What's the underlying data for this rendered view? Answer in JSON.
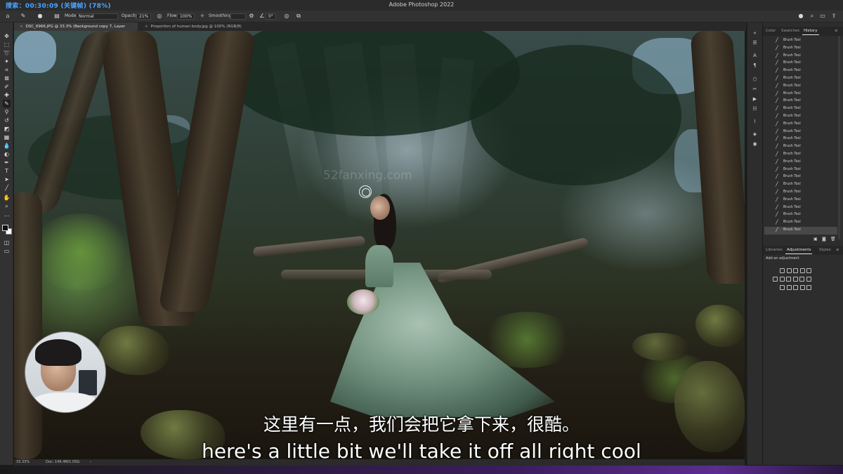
{
  "overlay": {
    "timer": "搜索：00:30:09 (关键帧) (78%)"
  },
  "app": {
    "title": "Adobe Photoshop 2022"
  },
  "options": {
    "mode_label": "Mode:",
    "mode_value": "Normal",
    "opacity_label": "Opacity:",
    "opacity_value": "21%",
    "flow_label": "Flow:",
    "flow_value": "100%",
    "smoothing_label": "Smoothing:",
    "angle_value": "0°"
  },
  "tabs": [
    {
      "label": "DSC_6966.JPG @ 33.3% (Background copy 7, Layer Mask/8) *"
    },
    {
      "label": "Proportion of human body.jpg @ 100% (RGB/8)"
    }
  ],
  "canvas": {
    "watermark": "52fanxing.com"
  },
  "subtitles": {
    "chinese": "这里有一点，我们会把它拿下来，很酷。",
    "english": "here's a little bit we'll take it off all right cool"
  },
  "status": {
    "zoom": "33.33%",
    "doc": "Doc: 149.4M/1.05G"
  },
  "panels": {
    "top_tabs": [
      "Color",
      "Swatches",
      "History"
    ],
    "history_item": "Brush Tool",
    "history_count": 26,
    "bottom_tabs": [
      "Libraries",
      "Adjustments",
      "Styles"
    ],
    "add_adjustment": "Add an adjustment"
  },
  "icons": {
    "home": "home-icon",
    "brush": "brush-icon",
    "close": "close-icon",
    "search": "search-icon",
    "share": "share-icon"
  }
}
